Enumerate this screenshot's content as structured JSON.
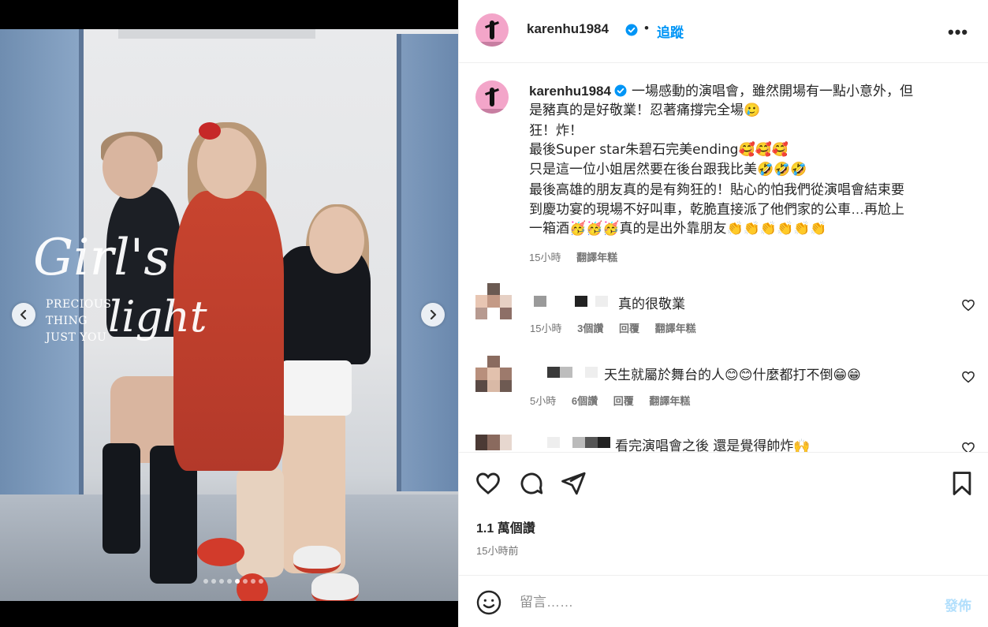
{
  "post": {
    "username": "karenhu1984",
    "follow_label": "追蹤",
    "separator": "•",
    "more_label": "•••"
  },
  "media": {
    "overlay_script_line1": "Girl's",
    "overlay_script_line2": "light",
    "overlay_small": [
      "PRECIOUS",
      "THING",
      "JUST YOU"
    ],
    "dots_count": 8,
    "active_dot_index": 4
  },
  "caption": {
    "username": "karenhu1984",
    "lines": [
      "一場感動的演唱會，雖然開場有一點小意外，但",
      "是豬真的是好敬業！忍著痛撐完全場🥲",
      "狂！炸！",
      "最後Super star朱碧石完美ending🥰🥰🥰",
      "只是這一位小姐居然要在後台跟我比美🤣🤣🤣",
      "最後高雄的朋友真的是有夠狂的！貼心的怕我們從演唱會結束要",
      "到慶功宴的現場不好叫車，乾脆直接派了他們家的公車…再尬上",
      "一箱酒🥳🥳🥳真的是出外靠朋友👏👏👏👏👏👏"
    ],
    "time": "15小時",
    "translate": "翻譯年糕"
  },
  "comments": [
    {
      "text": "真的很敬業",
      "time": "15小時",
      "likes": "3個讚",
      "reply": "回覆",
      "translate": "翻譯年糕"
    },
    {
      "text": "天生就屬於舞台的人😊😊什麼都打不倒😁😁",
      "time": "5小時",
      "likes": "6個讚",
      "reply": "回覆",
      "translate": "翻譯年糕"
    },
    {
      "text": "看完演唱會之後 還是覺得帥炸🙌"
    }
  ],
  "engagement": {
    "likes": "1.1 萬個讚",
    "timestamp": "15小時前"
  },
  "composer": {
    "placeholder": "留言……",
    "post_label": "發佈"
  },
  "colors": {
    "accent": "#0095f6",
    "post_disabled": "#b2dffc",
    "muted": "#737373"
  }
}
